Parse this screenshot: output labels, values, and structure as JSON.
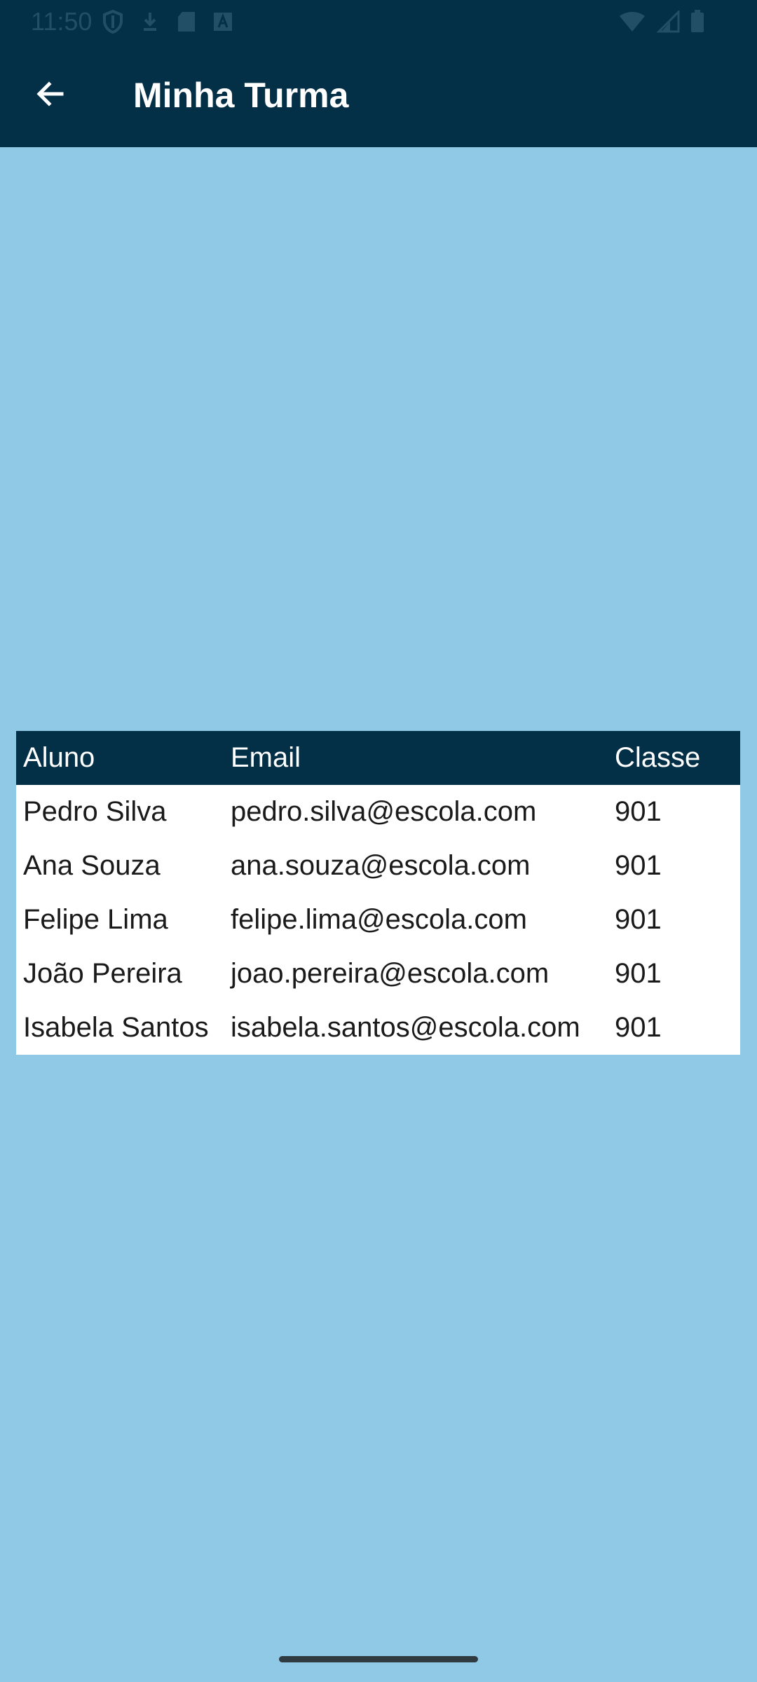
{
  "status_bar": {
    "time": "11:50",
    "left_icons": [
      "shield-icon",
      "download-icon",
      "sd-card-icon",
      "font-a-icon"
    ],
    "right_icons": [
      "wifi-icon",
      "signal-icon",
      "battery-icon"
    ]
  },
  "app_bar": {
    "title": "Minha Turma",
    "back_icon": "arrow-back-icon"
  },
  "table": {
    "headers": [
      "Aluno",
      "Email",
      "Classe"
    ],
    "rows": [
      [
        "Pedro Silva",
        "pedro.silva@escola.com",
        "901"
      ],
      [
        "Ana Souza",
        "ana.souza@escola.com",
        "901"
      ],
      [
        "Felipe Lima",
        "felipe.lima@escola.com",
        "901"
      ],
      [
        "João Pereira",
        "joao.pereira@escola.com",
        "901"
      ],
      [
        "Isabela Santos",
        "isabela.santos@escola.com",
        "901"
      ]
    ]
  },
  "colors": {
    "primary_dark": "#032f47",
    "background": "#90c9e5",
    "table_body": "#ffffff"
  }
}
